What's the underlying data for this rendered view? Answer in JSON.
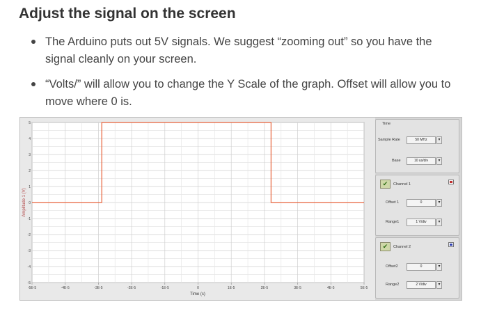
{
  "heading": "Adjust the signal on the screen",
  "bullets": [
    "The Arduino puts out 5V signals. We suggest “zooming out” so you have the signal cleanly on your screen.",
    "“Volts/” will allow you to change the Y Scale of the graph. Offset will allow you to move where 0 is."
  ],
  "controls": {
    "time_title": "Time",
    "sample_rate_label": "Sample Rate",
    "sample_rate_value": "50 MHz",
    "base_label": "Base",
    "base_value": "10 us/div",
    "channel1": {
      "label": "Channel 1",
      "offset_label": "Offset 1",
      "offset_value": "0",
      "range_label": "Range1",
      "range_value": "1 V/div"
    },
    "channel2": {
      "label": "Channel 2",
      "offset_label": "Offset2",
      "offset_value": "0",
      "range_label": "Range2",
      "range_value": "2 V/div"
    }
  },
  "chart_data": {
    "type": "line",
    "xlabel": "Time (s)",
    "ylabel": "Amplitude 1 (V)",
    "xlim": [
      -5e-05,
      5e-05
    ],
    "ylim": [
      -5,
      5
    ],
    "x_ticks": [
      "-5E-5",
      "-4E-5",
      "-3E-5",
      "-2E-5",
      "-1E-5",
      "0",
      "1E-5",
      "2E-5",
      "3E-5",
      "4E-5",
      "5E-5"
    ],
    "y_ticks": [
      "5",
      "4",
      "3",
      "2",
      "1",
      "0",
      "-1",
      "-2",
      "-3",
      "-4",
      "-5"
    ],
    "grid": true,
    "series": [
      {
        "color": "#e8623a",
        "x": [
          -5e-05,
          -2.9e-05,
          -2.9e-05,
          2.2e-05,
          2.2e-05,
          5e-05
        ],
        "y": [
          0,
          0,
          5,
          5,
          0,
          0
        ]
      }
    ]
  }
}
